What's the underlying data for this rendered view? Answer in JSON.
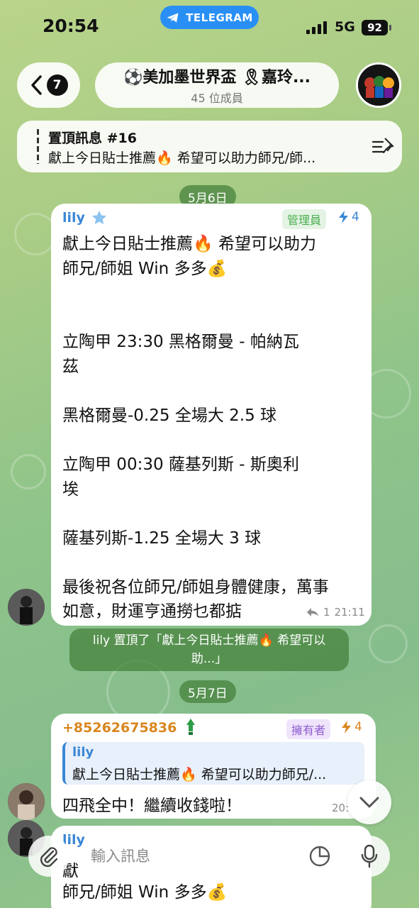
{
  "status_bar": {
    "time": "20:54",
    "app_pill": "TELEGRAM",
    "network": "5G",
    "battery": "92"
  },
  "header": {
    "back_badge": "7",
    "title": "⚽美加墨世界盃 🎗嘉玲...",
    "subtitle": "45 位成員",
    "avatar_icon": "group-avatar-mascots"
  },
  "pinned": {
    "title": "置頂訊息 #16",
    "text": "獻上今日貼士推薦🔥 希望可以助力師兄/師..."
  },
  "dates": {
    "first": "5月6日",
    "second": "5月7日"
  },
  "message1": {
    "sender": "lily",
    "role": "管理員",
    "boost": "4",
    "lines": [
      "獻上今日貼士推薦🔥 希望可以助力",
      "師兄/師姐 Win 多多💰",
      "立陶甲  23:30    黑格爾曼  -  帕納瓦",
      "茲",
      "黑格爾曼-0.25  全場大 2.5 球",
      "立陶甲  00:30    薩基列斯  -  斯奧利",
      "埃",
      "薩基列斯-1.25  全場大 3 球",
      "最後祝各位師兄/師姐身體健康，萬事",
      "如意，財運亨通撈乜都掂"
    ],
    "replies": "1",
    "time": "21:11"
  },
  "service": {
    "line1": "lily 置頂了「獻上今日貼士推薦🔥 希望可以",
    "line2": "助...」"
  },
  "message2": {
    "sender": "+85262675836",
    "role": "擁有者",
    "boost": "4",
    "quote_name": "lily",
    "quote_text": "獻上今日貼士推薦🔥 希望可以助力師兄/...",
    "text": "四飛全中！繼續收錢啦！",
    "time": "20:"
  },
  "message3_partial": {
    "sender": "lily",
    "line_top": "獻",
    "line": "師兄/師姐 Win 多多💰"
  },
  "input": {
    "placeholder": "輸入訊息"
  },
  "colors": {
    "accent": "#3a87d6",
    "admin_green": "#4caf50",
    "owner_purple": "#8e5bd0",
    "date_chip": "#5a9c4a"
  }
}
